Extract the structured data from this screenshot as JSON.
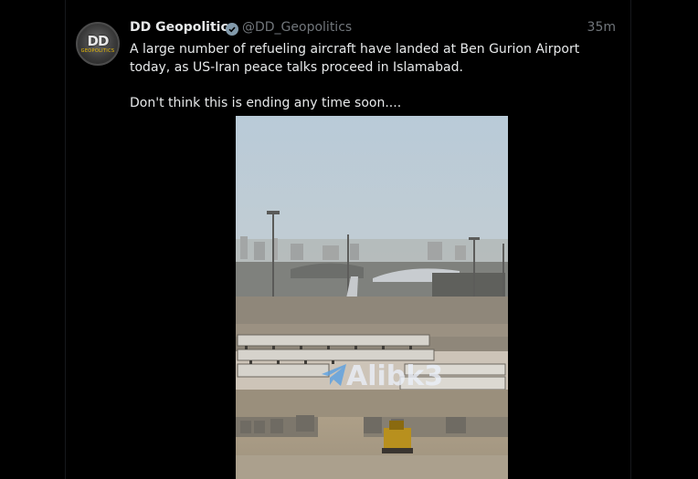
{
  "post": {
    "author_name": "DD Geopolitics",
    "handle": "@DD_Geopolitics",
    "time": "35m",
    "avatar_text": "DD",
    "avatar_subtext": "GEOPOLITICS",
    "text_line1": "A large number of refueling aircraft have landed at Ben Gurion Airport today, as US-Iran peace talks proceed in Islamabad.",
    "text_line2": "Don't think this is ending any time soon....",
    "media": {
      "watermark": "Alibk3",
      "watermark_icon": "telegram-icon"
    }
  },
  "colors": {
    "background": "#000000",
    "text": "#e7e9ea",
    "muted": "#71767b",
    "verified_badge": "#829aab"
  }
}
